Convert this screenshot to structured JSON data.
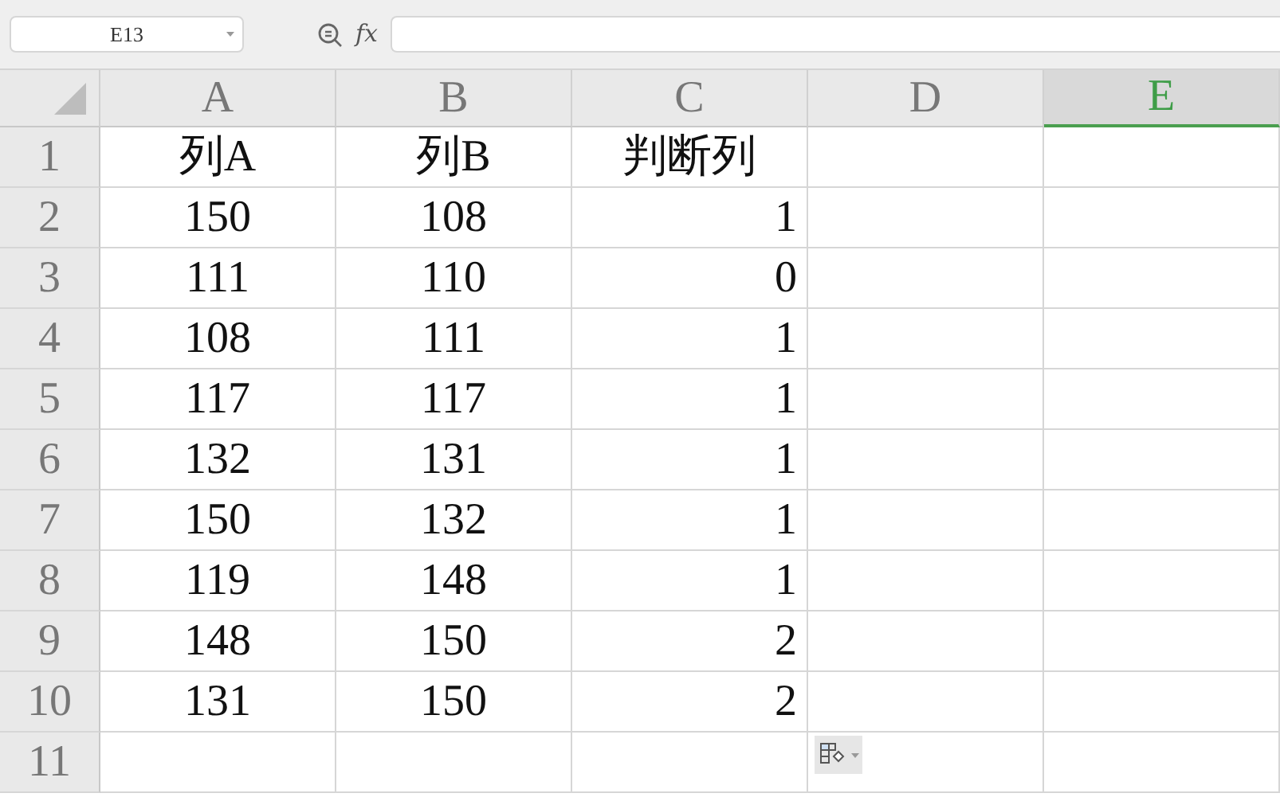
{
  "name_box": {
    "value": "E13"
  },
  "formula_bar": {
    "fx": "fx"
  },
  "columns": [
    {
      "label": "A",
      "selected": false
    },
    {
      "label": "B",
      "selected": false
    },
    {
      "label": "C",
      "selected": false
    },
    {
      "label": "D",
      "selected": false
    },
    {
      "label": "E",
      "selected": true
    }
  ],
  "rows": [
    {
      "number": "1",
      "cells": [
        "列A",
        "列B",
        "判断列"
      ]
    },
    {
      "number": "2",
      "cells": [
        "150",
        "108",
        "1"
      ]
    },
    {
      "number": "3",
      "cells": [
        "111",
        "110",
        "0"
      ]
    },
    {
      "number": "4",
      "cells": [
        "108",
        "111",
        "1"
      ]
    },
    {
      "number": "5",
      "cells": [
        "117",
        "117",
        "1"
      ]
    },
    {
      "number": "6",
      "cells": [
        "132",
        "131",
        "1"
      ]
    },
    {
      "number": "7",
      "cells": [
        "150",
        "132",
        "1"
      ]
    },
    {
      "number": "8",
      "cells": [
        "119",
        "148",
        "1"
      ]
    },
    {
      "number": "9",
      "cells": [
        "148",
        "150",
        "2"
      ]
    },
    {
      "number": "10",
      "cells": [
        "131",
        "150",
        "2"
      ]
    },
    {
      "number": "11",
      "cells": []
    }
  ]
}
